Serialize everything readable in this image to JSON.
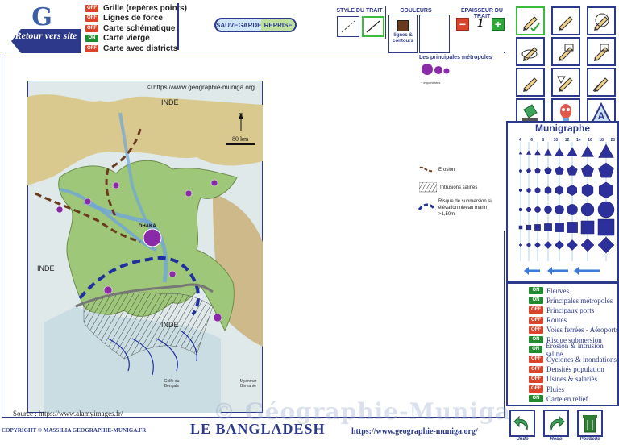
{
  "nav": {
    "logo_letter": "G",
    "back_button": "Retour vers site"
  },
  "options": [
    {
      "state": "OFF",
      "label": "Grille (repères points)"
    },
    {
      "state": "OFF",
      "label": "Lignes de force"
    },
    {
      "state": "OFF",
      "label": "Carte schématique"
    },
    {
      "state": "ON",
      "label": "Carte vierge"
    },
    {
      "state": "OFF",
      "label": "Carte avec districts"
    }
  ],
  "save_panel": {
    "save_label": "SAUVEGARDE",
    "reprise_label": "REPRISE"
  },
  "style_panel": {
    "title": "STYLE DU TRAIT"
  },
  "color_panel": {
    "title": "COULEURS",
    "caption": "lignes & contours",
    "selected_color": "#6b3a1e"
  },
  "thickness_panel": {
    "title": "ÉPAISSEUR DU TRAIT",
    "value": "1",
    "minus": "−",
    "plus": "+"
  },
  "legend": {
    "title": "Les principales métropoles",
    "sub": "+ importantes",
    "erosion": "Erosion",
    "intrusions": "Intrusions salines",
    "submersion": "Risque de submersion si élévation niveau marin >1,50m"
  },
  "map": {
    "copyright_note": "© https://www.geographie-muniga.org",
    "label_inde_top": "INDE",
    "label_inde_left": "INDE",
    "label_inde_bottom": "INDE",
    "scale": "80 km",
    "north": "N",
    "city_main": "DHAKA",
    "gulf": "Golfe du Bengale",
    "myanmar": "Myanmar Birmanie",
    "source": "Source : https://www.alamyimages.fr/"
  },
  "munigraphe": {
    "title": "Munigraphe",
    "sizes": [
      "4",
      "6",
      "8",
      "10",
      "12",
      "14",
      "16",
      "18",
      "20"
    ]
  },
  "layers": [
    {
      "state": "ON",
      "label": "Fleuves"
    },
    {
      "state": "ON",
      "label": "Principales métropoles"
    },
    {
      "state": "OFF",
      "label": "Principaux ports"
    },
    {
      "state": "OFF",
      "label": "Routes"
    },
    {
      "state": "OFF",
      "label": "Voies ferrées - Aéroports"
    },
    {
      "state": "ON",
      "label": "Risque submersion"
    },
    {
      "state": "ON",
      "label": "Erosion & intrusion saline"
    },
    {
      "state": "OFF",
      "label": "Cyclones & inondations"
    },
    {
      "state": "OFF",
      "label": "Densités population"
    },
    {
      "state": "OFF",
      "label": "Usines & salariés"
    },
    {
      "state": "OFF",
      "label": "Pluies"
    },
    {
      "state": "ON",
      "label": "Carte en relief"
    }
  ],
  "bottom_actions": {
    "undo": "Undo",
    "redo": "Redo",
    "trash": "Poubelle"
  },
  "footer": {
    "copyright": "COPYRIGHT © MASSILIA GEOGRAPHIE-MUNIGA.FR",
    "title": "LE BANGLADESH",
    "url": "https://www.geographie-muniga.org/"
  },
  "watermark": "© Géographie-Muniga",
  "colors": {
    "navy": "#2d3a8c",
    "on": "#1f8a2e",
    "off": "#d9442b",
    "erosion": "#6b3a1e",
    "submersion": "#1f2fa0",
    "city": "#8b2aa8"
  }
}
